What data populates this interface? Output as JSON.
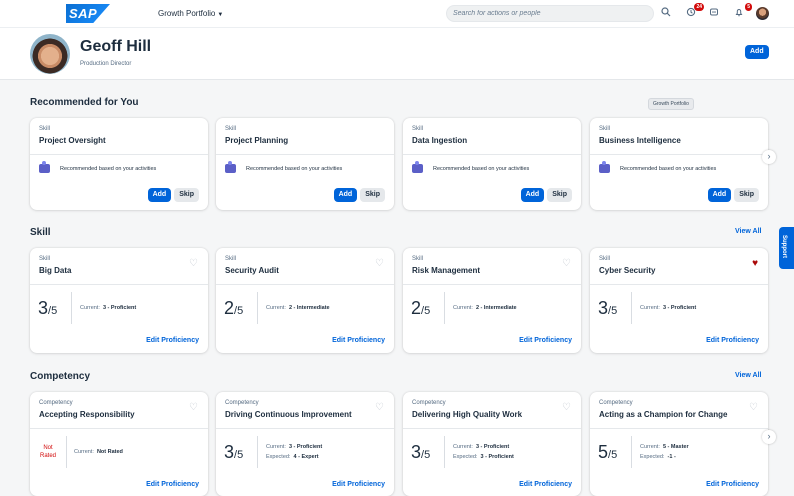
{
  "header": {
    "logo": "SAP",
    "product": "Growth Portfolio",
    "search_placeholder": "Search for actions or people",
    "notifications_badge": "24",
    "alerts_badge": "5"
  },
  "profile": {
    "name": "Geoff Hill",
    "title": "Production Director",
    "add_label": "Add"
  },
  "recommended": {
    "title": "Recommended for You",
    "tooltip": "Growth Portfolio",
    "cards": [
      {
        "type": "Skill",
        "name": "Project Oversight",
        "message": "Recommended based on your activities",
        "add": "Add",
        "skip": "Skip"
      },
      {
        "type": "Skill",
        "name": "Project Planning",
        "message": "Recommended based on your activities",
        "add": "Add",
        "skip": "Skip"
      },
      {
        "type": "Skill",
        "name": "Data Ingestion",
        "message": "Recommended based on your activities",
        "add": "Add",
        "skip": "Skip"
      },
      {
        "type": "Skill",
        "name": "Business Intelligence",
        "message": "Recommended based on your activities",
        "add": "Add",
        "skip": "Skip"
      }
    ]
  },
  "skill": {
    "title": "Skill",
    "view_all": "View All",
    "cards": [
      {
        "type": "Skill",
        "name": "Big Data",
        "score": "3",
        "out_of": "/5",
        "current_label": "Current:",
        "current": "3 - Proficient",
        "edit": "Edit Proficiency",
        "favorite": false
      },
      {
        "type": "Skill",
        "name": "Security Audit",
        "score": "2",
        "out_of": "/5",
        "current_label": "Current:",
        "current": "2 - Intermediate",
        "edit": "Edit Proficiency",
        "favorite": false
      },
      {
        "type": "Skill",
        "name": "Risk Management",
        "score": "2",
        "out_of": "/5",
        "current_label": "Current:",
        "current": "2 - Intermediate",
        "edit": "Edit Proficiency",
        "favorite": false
      },
      {
        "type": "Skill",
        "name": "Cyber Security",
        "score": "3",
        "out_of": "/5",
        "current_label": "Current:",
        "current": "3 - Proficient",
        "edit": "Edit Proficiency",
        "favorite": true
      }
    ]
  },
  "competency": {
    "title": "Competency",
    "view_all": "View All",
    "cards": [
      {
        "type": "Competency",
        "name": "Accepting Responsibility",
        "not_rated": "Not Rated",
        "current_label": "Current:",
        "current": "Not Rated",
        "edit": "Edit Proficiency"
      },
      {
        "type": "Competency",
        "name": "Driving Continuous Improvement",
        "score": "3",
        "out_of": "/5",
        "current_label": "Current:",
        "current": "3 - Proficient",
        "expected_label": "Expected:",
        "expected": "4 - Expert",
        "edit": "Edit Proficiency"
      },
      {
        "type": "Competency",
        "name": "Delivering High Quality Work",
        "score": "3",
        "out_of": "/5",
        "current_label": "Current:",
        "current": "3 - Proficient",
        "expected_label": "Expected:",
        "expected": "3 - Proficient",
        "edit": "Edit Proficiency"
      },
      {
        "type": "Competency",
        "name": "Acting as a Champion for Change",
        "score": "5",
        "out_of": "/5",
        "current_label": "Current:",
        "current": "5 - Master",
        "expected_label": "Expected:",
        "expected": "-1 -",
        "edit": "Edit Proficiency"
      }
    ]
  },
  "support_label": "Support",
  "colors": {
    "accent": "#0064d9",
    "negative": "#d20a0a",
    "favorite": "#aa0808"
  }
}
